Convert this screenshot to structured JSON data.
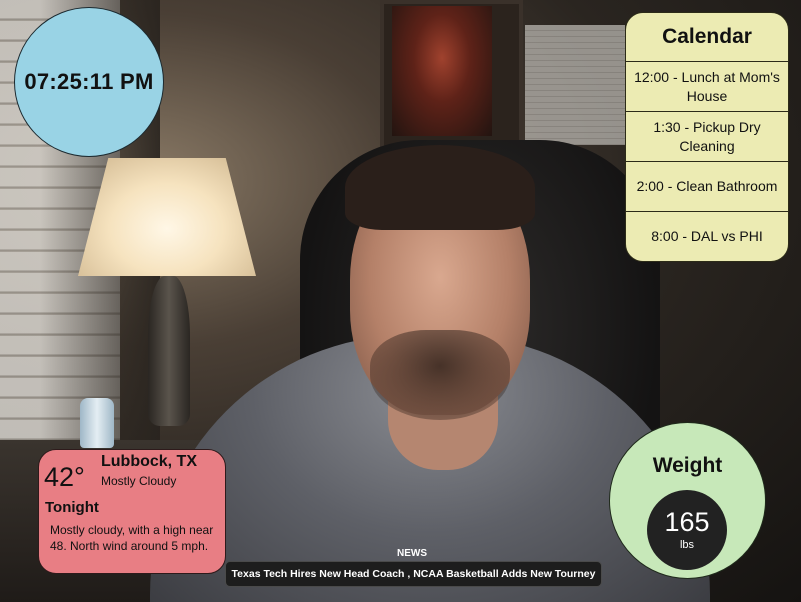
{
  "clock": {
    "time": "07:25:11 PM"
  },
  "calendar": {
    "title": "Calendar",
    "events": [
      "12:00 - Lunch at Mom's House",
      "1:30 - Pickup Dry Cleaning",
      "2:00 - Clean Bathroom",
      "8:00 - DAL vs PHI"
    ]
  },
  "weather": {
    "temperature": "42°",
    "city": "Lubbock, TX",
    "condition": "Mostly Cloudy",
    "period": "Tonight",
    "forecast": "Mostly cloudy, with a high near 48. North wind around 5 mph."
  },
  "weight": {
    "title": "Weight",
    "value": "165",
    "unit": "lbs"
  },
  "news": {
    "label": "NEWS",
    "headlines": "Texas Tech Hires New Head Coach ,  NCAA Basketball Adds New Tourney"
  },
  "colors": {
    "clock_bg": "#99d3e5",
    "calendar_bg": "#ecebb3",
    "weather_bg": "#e87e84",
    "weight_bg": "#c7e8b9",
    "news_bg": "#1d1d1d"
  }
}
